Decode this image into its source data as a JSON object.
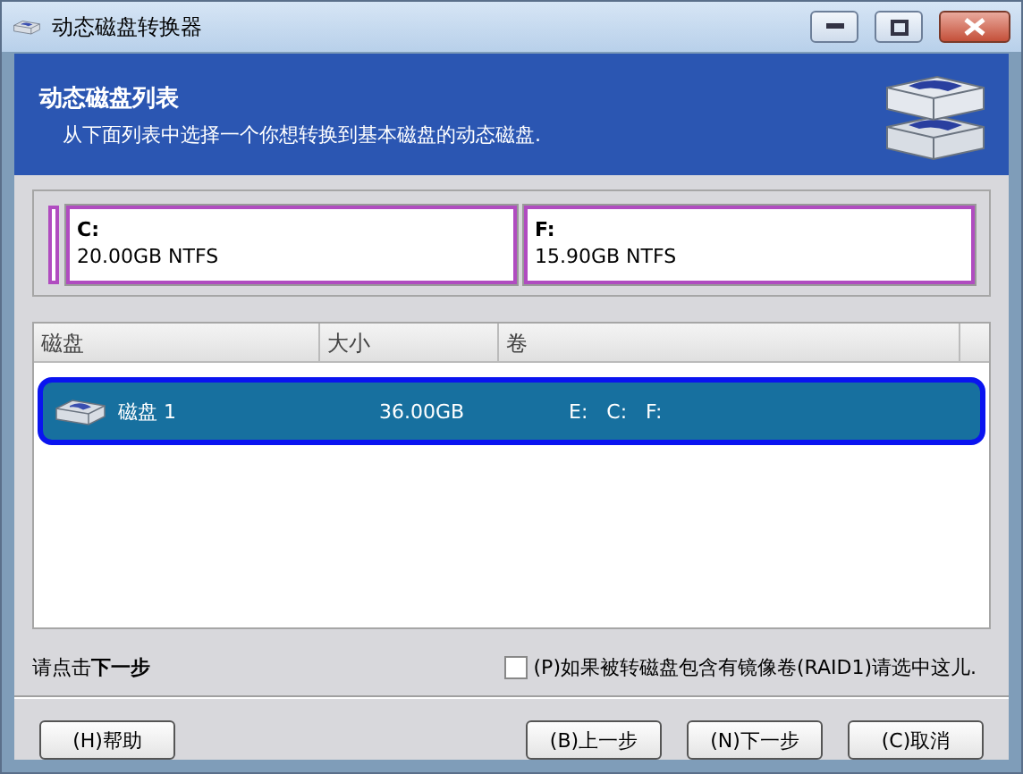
{
  "window": {
    "title": "动态磁盘转换器"
  },
  "header": {
    "title": "动态磁盘列表",
    "subtitle": "从下面列表中选择一个你想转换到基本磁盘的动态磁盘."
  },
  "partitions": [
    {
      "kind": "sliver"
    },
    {
      "kind": "volume",
      "letter": "C:",
      "info": "20.00GB NTFS"
    },
    {
      "kind": "volume",
      "letter": "F:",
      "info": "15.90GB NTFS"
    }
  ],
  "table": {
    "columns": [
      "磁盘",
      "大小",
      "卷"
    ],
    "rows": [
      {
        "disk": "磁盘 1",
        "size": "36.00GB",
        "volumes": "E:   C:   F:",
        "selected": true
      }
    ]
  },
  "hint": "请点击**下一步**",
  "mirror_option": {
    "label": "(P)如果被转磁盘包含有镜像卷(RAID1)请选中这儿.",
    "checked": false
  },
  "buttons": [
    {
      "label": "(H)帮助"
    },
    {
      "label": "(B)上一步"
    },
    {
      "label": "(N)下一步"
    },
    {
      "label": "(C)取消"
    }
  ]
}
